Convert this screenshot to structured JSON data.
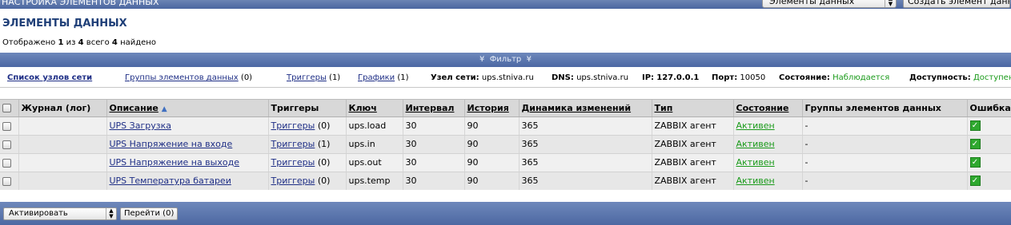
{
  "topbar": {
    "title": "НАСТРОЙКА ЭЛЕМЕНТОВ ДАННЫХ",
    "select_value": "Элементы данных",
    "create_label": "Создать элемент данных"
  },
  "page_title": "ЭЛЕМЕНТЫ ДАННЫХ",
  "shown": {
    "prefix": "Отображено",
    "from": "1",
    "of_label": "из",
    "to": "4",
    "total_label": "всего",
    "found": "4",
    "found_label": "найдено"
  },
  "filter": {
    "label": "Фильтр"
  },
  "hostbar": {
    "host_list": "Список узлов сети",
    "item_groups": "Группы элементов данных",
    "item_groups_count": "(0)",
    "triggers": "Триггеры",
    "triggers_count": "(1)",
    "graphs": "Графики",
    "graphs_count": "(1)",
    "host_label": "Узел сети:",
    "host_value": "ups.stniva.ru",
    "dns_label": "DNS:",
    "dns_value": "ups.stniva.ru",
    "ip_label": "IP:",
    "ip_value": "127.0.0.1",
    "port_label": "Порт:",
    "port_value": "10050",
    "status_label": "Состояние:",
    "status_value": "Наблюдается",
    "avail_label": "Доступность:",
    "avail_value": "Доступен"
  },
  "table": {
    "headers": {
      "log": "Журнал (лог)",
      "description": "Описание",
      "triggers": "Триггеры",
      "key": "Ключ",
      "interval": "Интервал",
      "history": "История",
      "trends": "Динамика изменений",
      "type": "Тип",
      "status": "Состояние",
      "groups": "Группы элементов данных",
      "error": "Ошибка"
    },
    "rows": [
      {
        "description": "UPS Загрузка",
        "triggers": "Триггеры",
        "triggers_count": "(0)",
        "key": "ups.load",
        "interval": "30",
        "history": "90",
        "trends": "365",
        "type": "ZABBIX агент",
        "status": "Активен",
        "groups": "-"
      },
      {
        "description": "UPS Напряжение на входе",
        "triggers": "Триггеры",
        "triggers_count": "(1)",
        "key": "ups.in",
        "interval": "30",
        "history": "90",
        "trends": "365",
        "type": "ZABBIX агент",
        "status": "Активен",
        "groups": "-"
      },
      {
        "description": "UPS Напряжение на выходе",
        "triggers": "Триггеры",
        "triggers_count": "(0)",
        "key": "ups.out",
        "interval": "30",
        "history": "90",
        "trends": "365",
        "type": "ZABBIX агент",
        "status": "Активен",
        "groups": "-"
      },
      {
        "description": "UPS Температура батареи",
        "triggers": "Триггеры",
        "triggers_count": "(0)",
        "key": "ups.temp",
        "interval": "30",
        "history": "90",
        "trends": "365",
        "type": "ZABBIX агент",
        "status": "Активен",
        "groups": "-"
      }
    ]
  },
  "bottom": {
    "action_value": "Активировать",
    "go_label": "Перейти (0)"
  },
  "colors": {
    "bar_blue": "#4c68a3",
    "title_blue": "#1f3f78",
    "link_blue": "#1f2f86",
    "status_green": "#1a9a1a",
    "ok_green": "#2fa82f"
  },
  "icons": {
    "sort": "sort-asc-icon",
    "ok": "check-icon",
    "filter": "chevron-down-double-icon"
  }
}
